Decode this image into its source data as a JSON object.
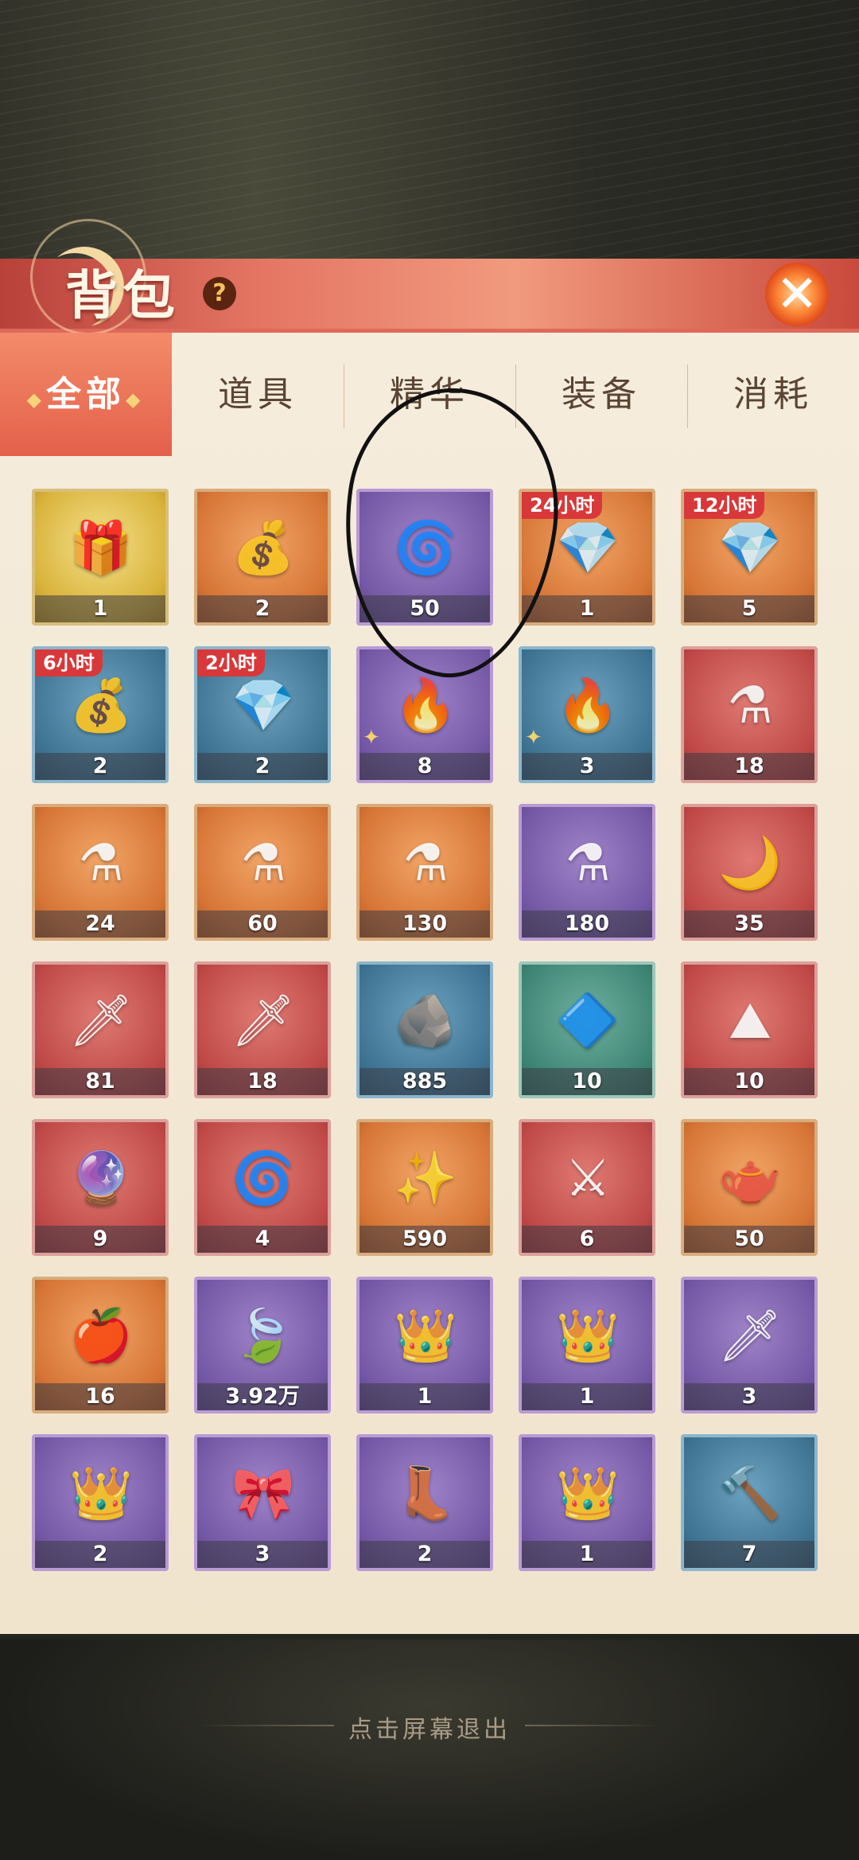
{
  "header": {
    "title": "背包",
    "help": "?",
    "close": "✕"
  },
  "tabs": [
    {
      "label": "全部",
      "active": true
    },
    {
      "label": "道具",
      "active": false
    },
    {
      "label": "精华",
      "active": false
    },
    {
      "label": "装备",
      "active": false
    },
    {
      "label": "消耗",
      "active": false
    }
  ],
  "items": [
    {
      "name": "golden-chest",
      "count": "1",
      "quality": "gold",
      "icon": "chest-icon",
      "glyph": "🎁",
      "timer": ""
    },
    {
      "name": "treasure-bag",
      "count": "2",
      "quality": "orange",
      "icon": "bag-icon",
      "glyph": "💰",
      "timer": ""
    },
    {
      "name": "essence-chest",
      "count": "50",
      "quality": "purple",
      "icon": "chest-icon",
      "glyph": "🌀",
      "timer": ""
    },
    {
      "name": "gem-chest-24h",
      "count": "1",
      "quality": "orange",
      "icon": "chest-icon",
      "glyph": "💎",
      "timer": "24小时"
    },
    {
      "name": "gem-chest-12h",
      "count": "5",
      "quality": "orange",
      "icon": "chest-icon",
      "glyph": "💎",
      "timer": "12小时"
    },
    {
      "name": "gem-bag-6h",
      "count": "2",
      "quality": "blue",
      "icon": "bag-icon",
      "glyph": "💰",
      "timer": "6小时"
    },
    {
      "name": "gem-pile-2h",
      "count": "2",
      "quality": "blue",
      "icon": "gem-icon",
      "glyph": "💎",
      "timer": "2小时"
    },
    {
      "name": "purple-flame-shard",
      "count": "8",
      "quality": "purple",
      "icon": "flame-icon",
      "glyph": "🔥",
      "timer": "",
      "piece": true
    },
    {
      "name": "blue-flame-shard",
      "count": "3",
      "quality": "blue",
      "icon": "flame-icon",
      "glyph": "🔥",
      "timer": "",
      "piece": true
    },
    {
      "name": "green-potion",
      "count": "18",
      "quality": "red",
      "icon": "potion-icon",
      "glyph": "⚗",
      "timer": ""
    },
    {
      "name": "purple-potion",
      "count": "24",
      "quality": "orange",
      "icon": "potion-icon",
      "glyph": "⚗",
      "timer": ""
    },
    {
      "name": "red-potion",
      "count": "60",
      "quality": "orange",
      "icon": "potion-icon",
      "glyph": "⚗",
      "timer": ""
    },
    {
      "name": "green-flask",
      "count": "130",
      "quality": "orange",
      "icon": "potion-icon",
      "glyph": "⚗",
      "timer": ""
    },
    {
      "name": "pink-flask",
      "count": "180",
      "quality": "purple",
      "icon": "potion-icon",
      "glyph": "⚗",
      "timer": ""
    },
    {
      "name": "moon-staff",
      "count": "35",
      "quality": "red",
      "icon": "staff-icon",
      "glyph": "🌙",
      "timer": ""
    },
    {
      "name": "golden-spear",
      "count": "81",
      "quality": "red",
      "icon": "spear-icon",
      "glyph": "🗡",
      "timer": ""
    },
    {
      "name": "dark-sword",
      "count": "18",
      "quality": "red",
      "icon": "sword-icon",
      "glyph": "🗡",
      "timer": ""
    },
    {
      "name": "ore-stone",
      "count": "885",
      "quality": "blue",
      "icon": "ore-icon",
      "glyph": "🪨",
      "timer": ""
    },
    {
      "name": "dark-crystal",
      "count": "10",
      "quality": "green",
      "icon": "crystal-icon",
      "glyph": "🔷",
      "timer": ""
    },
    {
      "name": "salt-tray",
      "count": "10",
      "quality": "red",
      "icon": "tray-icon",
      "glyph": "⛰",
      "timer": ""
    },
    {
      "name": "flame-orb",
      "count": "9",
      "quality": "red",
      "icon": "orb-icon",
      "glyph": "🔮",
      "timer": ""
    },
    {
      "name": "red-swirl",
      "count": "4",
      "quality": "red",
      "icon": "swirl-icon",
      "glyph": "🌀",
      "timer": ""
    },
    {
      "name": "gold-crystal",
      "count": "590",
      "quality": "orange",
      "icon": "crystal-icon",
      "glyph": "✨",
      "timer": ""
    },
    {
      "name": "sword-banner",
      "count": "6",
      "quality": "red",
      "icon": "banner-icon",
      "glyph": "⚔",
      "timer": ""
    },
    {
      "name": "magic-lamp",
      "count": "50",
      "quality": "orange",
      "icon": "lamp-icon",
      "glyph": "🫖",
      "timer": ""
    },
    {
      "name": "red-fruit",
      "count": "16",
      "quality": "orange",
      "icon": "fruit-icon",
      "glyph": "🍎",
      "timer": ""
    },
    {
      "name": "crystal-leaf",
      "count": "3.92万",
      "quality": "purple",
      "icon": "leaf-icon",
      "glyph": "🍃",
      "timer": ""
    },
    {
      "name": "golden-crown",
      "count": "1",
      "quality": "purple",
      "icon": "crown-icon",
      "glyph": "👑",
      "timer": ""
    },
    {
      "name": "golden-crown-plus",
      "count": "1",
      "quality": "purple",
      "icon": "crown-icon",
      "glyph": "👑",
      "timer": ""
    },
    {
      "name": "purple-dagger",
      "count": "3",
      "quality": "purple",
      "icon": "dagger-icon",
      "glyph": "🗡",
      "timer": ""
    },
    {
      "name": "silver-circlet",
      "count": "2",
      "quality": "purple",
      "icon": "circlet-icon",
      "glyph": "👑",
      "timer": ""
    },
    {
      "name": "silk-belt",
      "count": "3",
      "quality": "purple",
      "icon": "belt-icon",
      "glyph": "🎀",
      "timer": ""
    },
    {
      "name": "purple-boots",
      "count": "2",
      "quality": "purple",
      "icon": "boots-icon",
      "glyph": "👢",
      "timer": ""
    },
    {
      "name": "jeweled-crown",
      "count": "1",
      "quality": "purple",
      "icon": "crown-icon",
      "glyph": "👑",
      "timer": ""
    },
    {
      "name": "spiked-mace",
      "count": "7",
      "quality": "blue",
      "icon": "mace-icon",
      "glyph": "🔨",
      "timer": ""
    }
  ],
  "footer": {
    "exit_hint": "点击屏幕退出"
  }
}
